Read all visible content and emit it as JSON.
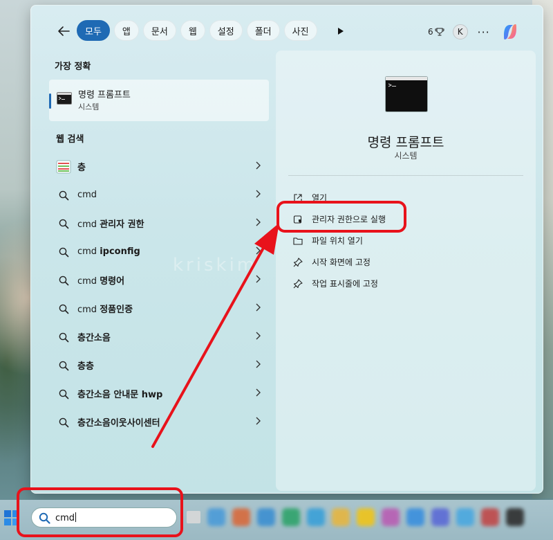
{
  "filter_bar": {
    "chips": [
      "모두",
      "앱",
      "문서",
      "웹",
      "설정",
      "폴더",
      "사진"
    ],
    "active_chip": "모두",
    "points": "6",
    "avatar_initial": "K",
    "more_label": "···"
  },
  "best_match": {
    "section_title": "가장 정확",
    "title": "명령 프롬프트",
    "subtitle": "시스템"
  },
  "web_search": {
    "section_title": "웹 검색",
    "items": [
      {
        "prefix": "",
        "bold": "층",
        "icon": "web-result-icon"
      },
      {
        "prefix": "cmd",
        "bold": "",
        "icon": "search-icon"
      },
      {
        "prefix": "cmd ",
        "bold": "관리자 권한",
        "icon": "search-icon"
      },
      {
        "prefix": "cmd ",
        "bold": "ipconfig",
        "icon": "search-icon"
      },
      {
        "prefix": "cmd ",
        "bold": "명령어",
        "icon": "search-icon"
      },
      {
        "prefix": "cmd ",
        "bold": "정품인증",
        "icon": "search-icon"
      },
      {
        "prefix": "",
        "bold": "층간소음",
        "icon": "search-icon"
      },
      {
        "prefix": "",
        "bold": "층층",
        "icon": "search-icon"
      },
      {
        "prefix": "",
        "bold": "층간소음 안내문 hwp",
        "icon": "search-icon"
      },
      {
        "prefix": "",
        "bold": "층간소음이웃사이센터",
        "icon": "search-icon"
      }
    ]
  },
  "preview": {
    "title": "명령 프롬프트",
    "subtitle": "시스템",
    "actions": [
      {
        "label": "열기",
        "icon": "open-icon"
      },
      {
        "label": "관리자 권한으로 실행",
        "icon": "admin-shield-icon"
      },
      {
        "label": "파일 위치 열기",
        "icon": "folder-icon"
      },
      {
        "label": "시작 화면에 고정",
        "icon": "pin-icon"
      },
      {
        "label": "작업 표시줄에 고정",
        "icon": "pin-icon"
      }
    ]
  },
  "watermark": "kriskim",
  "taskbar": {
    "search_value": "cmd"
  },
  "colors": {
    "accent": "#1f6ab4",
    "annotation": "#e8121b"
  }
}
